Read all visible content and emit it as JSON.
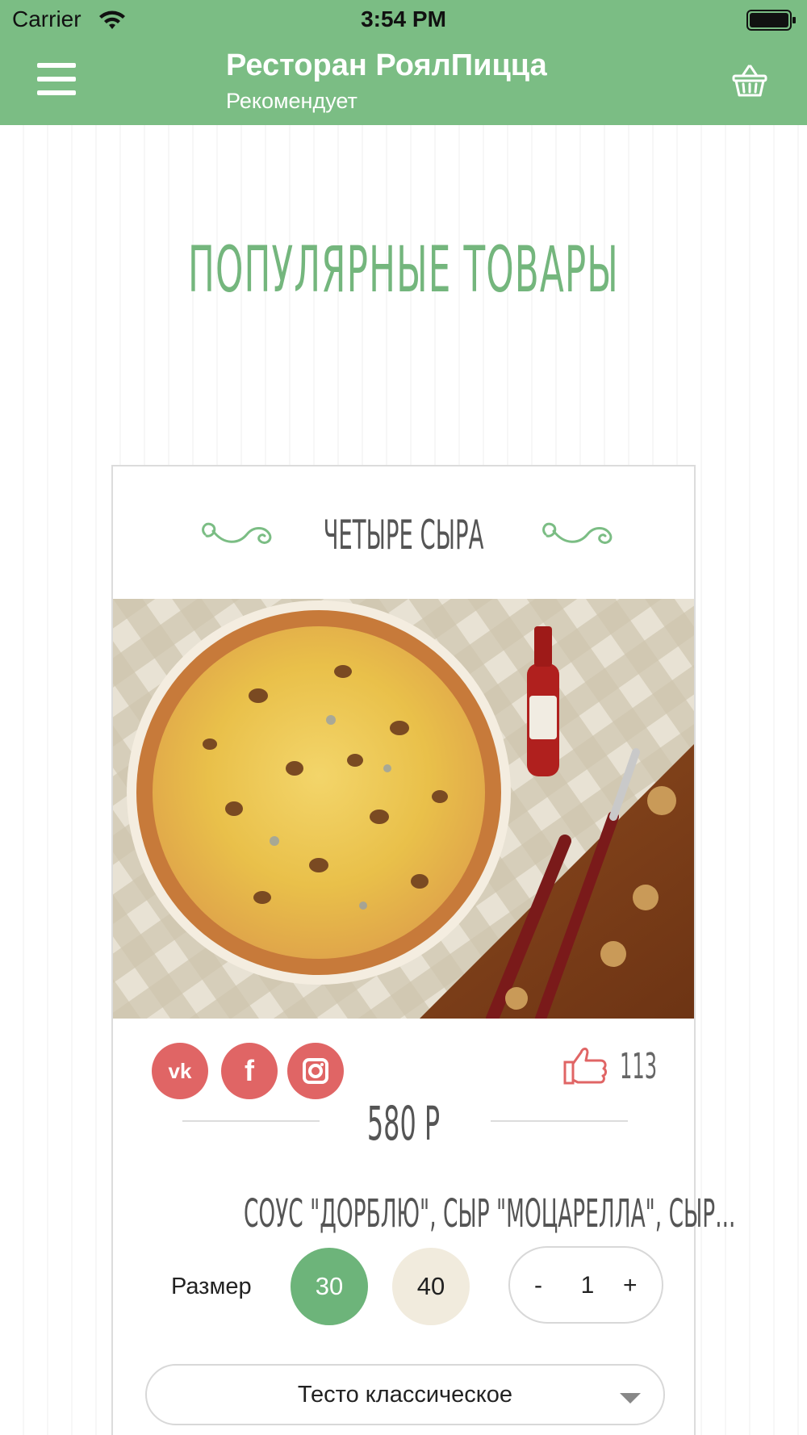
{
  "status_bar": {
    "carrier": "Carrier",
    "time": "3:54 PM"
  },
  "nav": {
    "title": "Ресторан РоялПицца",
    "subtitle": "Рекомендует",
    "icons": [
      "menu-icon",
      "basket-icon"
    ]
  },
  "section": {
    "title": "ПОПУЛЯРНЫЕ ТОВАРЫ"
  },
  "product": {
    "name": "ЧЕТЫРЕ СЫРА",
    "likes": "113",
    "price": "580 Р",
    "ingredients": "СОУС \"ДОРБЛЮ\", СЫР \"МОЦАРЕЛЛА\", СЫР...",
    "size_label": "Размер",
    "sizes": [
      "30",
      "40"
    ],
    "selected_size": "30",
    "quantity": "1",
    "minus_label": "-",
    "plus_label": "+",
    "dough": "Тесто классическое",
    "social": [
      "vk-icon",
      "facebook-icon",
      "instagram-icon"
    ]
  },
  "colors": {
    "accent_green": "#7bbd84",
    "selected_size": "#6db47a",
    "unselected_size": "#f1ebdd",
    "social_red": "#e06565"
  }
}
